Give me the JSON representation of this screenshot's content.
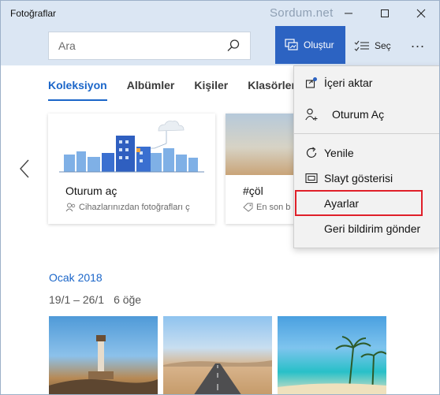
{
  "window": {
    "title": "Fotoğraflar",
    "watermark": "Sordum.net"
  },
  "toolbar": {
    "search_placeholder": "Ara",
    "create_label": "Oluştur",
    "select_label": "Seç",
    "more_label": "...",
    "accent_color": "#2c63c2"
  },
  "tabs": [
    {
      "label": "Koleksiyon",
      "active": true
    },
    {
      "label": "Albümler",
      "active": false
    },
    {
      "label": "Kişiler",
      "active": false
    },
    {
      "label": "Klasörler",
      "active": false
    }
  ],
  "cards": [
    {
      "title": "Oturum aç",
      "subtitle": "Cihazlarınızdan fotoğrafları ç",
      "icon": "people-icon"
    },
    {
      "title": "#çöl",
      "subtitle": "En son b",
      "icon": "tag-icon"
    }
  ],
  "section": {
    "date_heading": "Ocak 2018",
    "range": "19/1 – 26/1",
    "count": "6 öğe"
  },
  "menu": {
    "items": [
      {
        "label": "İçeri aktar",
        "icon": "import-icon"
      },
      {
        "label": "Oturum Aç",
        "icon": "user-add-icon"
      },
      {
        "label": "Yenile",
        "icon": "refresh-icon"
      },
      {
        "label": "Slayt gösterisi",
        "icon": "slideshow-icon"
      },
      {
        "label": "Ayarlar",
        "icon": "",
        "highlighted": true
      },
      {
        "label": "Geri bildirim gönder",
        "icon": ""
      }
    ],
    "highlight_color": "#e0202a"
  }
}
